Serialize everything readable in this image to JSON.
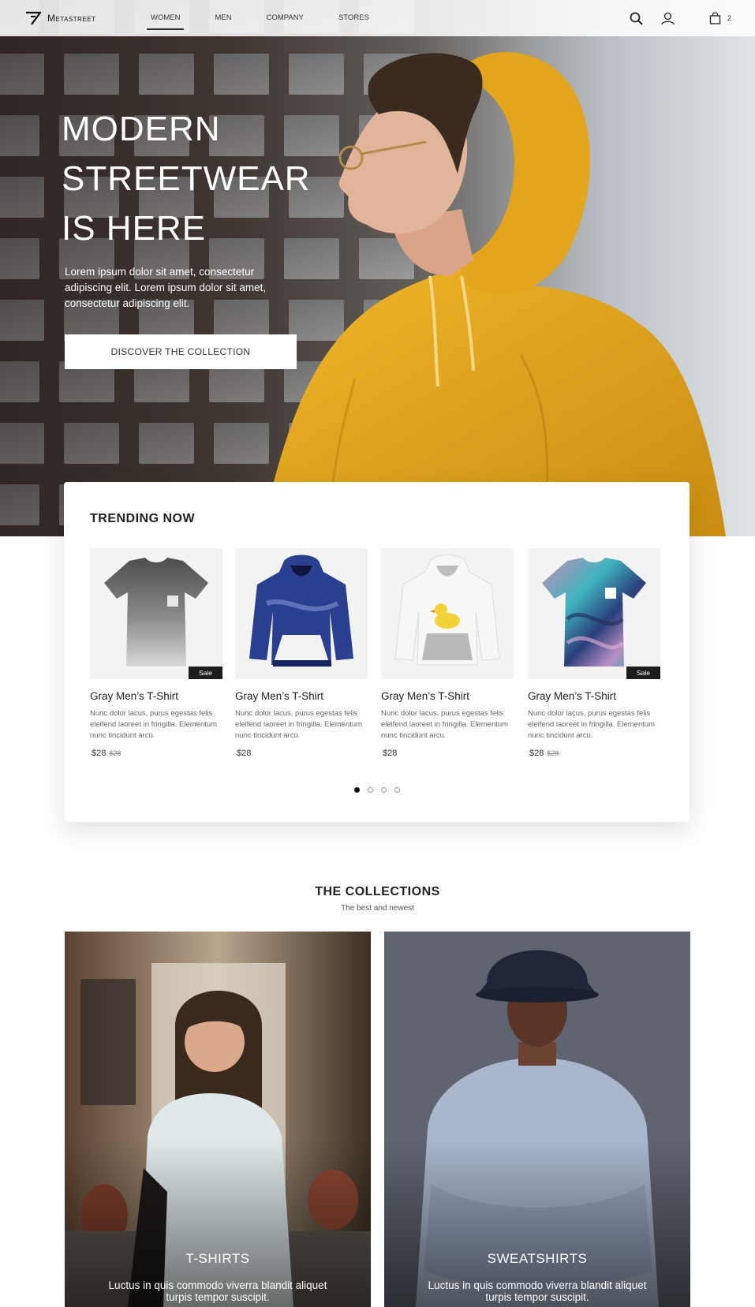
{
  "brand": {
    "name": "Metastreet"
  },
  "nav": {
    "links": [
      {
        "label": "WOMEN",
        "active": true
      },
      {
        "label": "MEN",
        "active": false
      },
      {
        "label": "COMPANY",
        "active": false
      },
      {
        "label": "STORES",
        "active": false
      }
    ],
    "icons": [
      "search-icon",
      "user-icon",
      "shopping-bag-icon"
    ],
    "cart_count": "2"
  },
  "hero": {
    "title_lines": [
      "MODERN",
      "STREETWEAR",
      "IS HERE"
    ],
    "description": "Lorem ipsum dolor sit amet, consectetur adipiscing elit. Lorem ipsum dolor sit amet, consectetur adipiscing elit.",
    "cta_label": "DISCOVER THE COLLECTION"
  },
  "trending": {
    "title": "TRENDING NOW",
    "products": [
      {
        "name": "Gray Men’s T-Shirt",
        "description": "Nunc dolor lacus, purus egestas felis eleifend laoreet in fringilla. Elementum nunc tincidunt arcu.",
        "price": "$28",
        "old_price": "$28",
        "sale": true,
        "sale_label": "Sale",
        "image": "gray-tshirt"
      },
      {
        "name": "Gray Men’s T-Shirt",
        "description": "Nunc dolor lacus, purus egestas felis eleifend laoreet in fringilla. Elementum nunc tincidunt arcu.",
        "price": "$28",
        "old_price": "",
        "sale": false,
        "sale_label": "",
        "image": "blue-hoodie"
      },
      {
        "name": "Gray Men’s T-Shirt",
        "description": "Nunc dolor lacus, purus egestas felis eleifend laoreet in fringilla. Elementum nunc tincidunt arcu.",
        "price": "$28",
        "old_price": "",
        "sale": false,
        "sale_label": "",
        "image": "white-duck-hoodie"
      },
      {
        "name": "Gray Men’s T-Shirt",
        "description": "Nunc dolor lacus, purus egestas felis eleifend laoreet in fringilla. Elementum nunc tincidunt arcu.",
        "price": "$28",
        "old_price": "$28",
        "sale": true,
        "sale_label": "Sale",
        "image": "marble-tshirt"
      }
    ],
    "pager": {
      "pages": 4,
      "active": 0
    }
  },
  "collections": {
    "title": "THE COLLECTIONS",
    "subtitle": "The best and newest",
    "cards": [
      {
        "label": "T-SHIRTS",
        "text": "Luctus in quis commodo viverra blandit aliquet turpis tempor suscipit."
      },
      {
        "label": "SWEATSHIRTS",
        "text": "Luctus in quis commodo viverra blandit aliquet turpis tempor suscipit."
      }
    ]
  },
  "colors": {
    "accent": "#E3A91C",
    "dark": "#1C1C1C"
  }
}
